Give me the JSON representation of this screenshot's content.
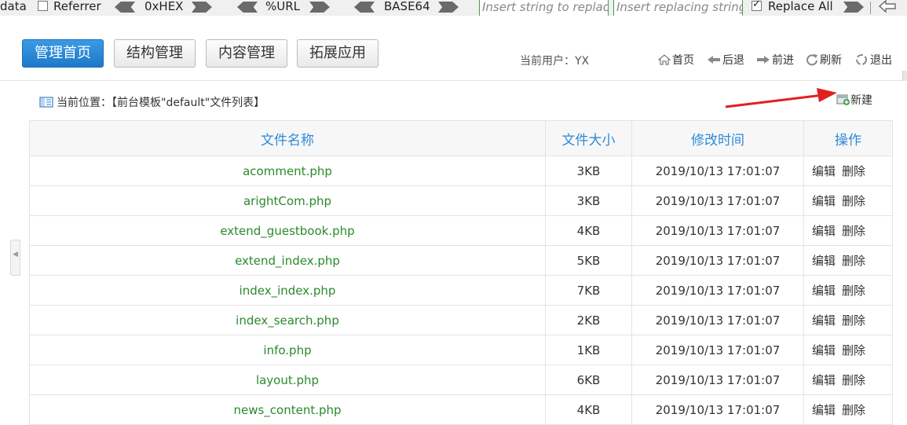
{
  "toolbar": {
    "data_label": "data",
    "referrer_label": "Referrer",
    "hex_label": "0xHEX",
    "url_label": "%URL",
    "base64_label": "BASE64",
    "insert_placeholder": "Insert string to replac",
    "replacing_placeholder": "Insert replacing string",
    "replace_all_label": "Replace All"
  },
  "header": {
    "nav": [
      "管理首页",
      "结构管理",
      "内容管理",
      "拓展应用"
    ],
    "current_user": "当前用户：YX",
    "links": {
      "home": "首页",
      "back": "后退",
      "forward": "前进",
      "refresh": "刷新",
      "logout": "退出"
    }
  },
  "content": {
    "breadcrumb": "当前位置：【前台模板\"default\"文件列表】",
    "new_label": "新建",
    "columns": [
      "文件名称",
      "文件大小",
      "修改时间",
      "操作"
    ],
    "rows": [
      {
        "name": "acomment.php",
        "size": "3KB",
        "time": "2019/10/13 17:01:07"
      },
      {
        "name": "arightCom.php",
        "size": "3KB",
        "time": "2019/10/13 17:01:07"
      },
      {
        "name": "extend_guestbook.php",
        "size": "4KB",
        "time": "2019/10/13 17:01:07"
      },
      {
        "name": "extend_index.php",
        "size": "5KB",
        "time": "2019/10/13 17:01:07"
      },
      {
        "name": "index_index.php",
        "size": "7KB",
        "time": "2019/10/13 17:01:07"
      },
      {
        "name": "index_search.php",
        "size": "2KB",
        "time": "2019/10/13 17:01:07"
      },
      {
        "name": "info.php",
        "size": "1KB",
        "time": "2019/10/13 17:01:07"
      },
      {
        "name": "layout.php",
        "size": "6KB",
        "time": "2019/10/13 17:01:07"
      },
      {
        "name": "news_content.php",
        "size": "4KB",
        "time": "2019/10/13 17:01:07"
      }
    ],
    "edit_label": "编辑",
    "delete_label": "删除"
  },
  "colors": {
    "accent": "#2f8ad8",
    "filename": "#2a8a2a",
    "annotation_arrow": "#e02020"
  }
}
